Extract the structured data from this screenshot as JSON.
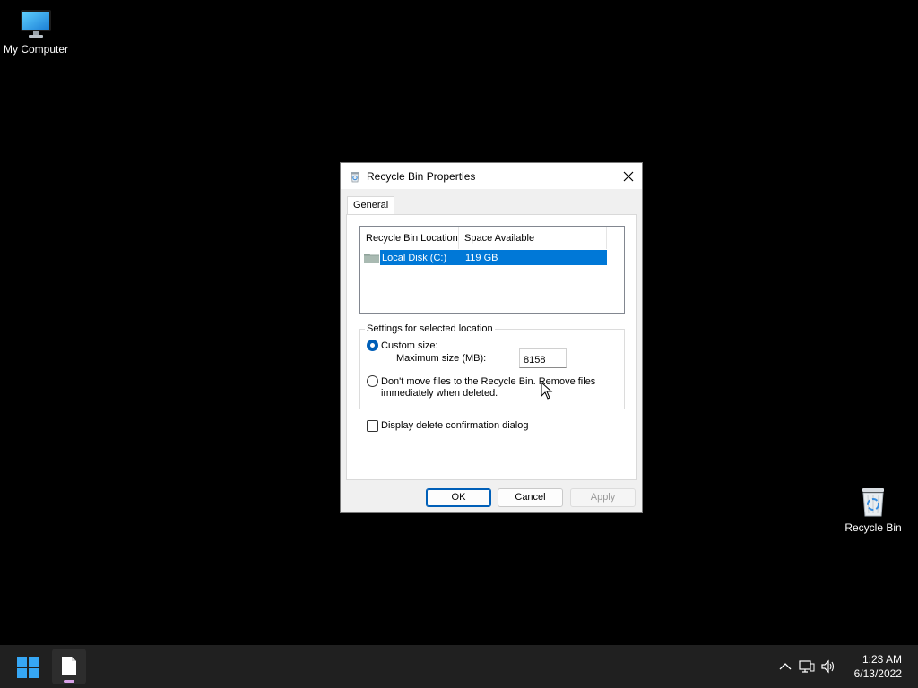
{
  "desktop": {
    "icons": [
      {
        "label": "My Computer",
        "icon": "monitor-icon"
      },
      {
        "label": "Recycle Bin",
        "icon": "recycle-bin-icon"
      }
    ]
  },
  "dialog": {
    "title": "Recycle Bin Properties",
    "tabs": [
      {
        "label": "General",
        "active": true
      }
    ],
    "list": {
      "columns": [
        "Recycle Bin Location",
        "Space Available"
      ],
      "rows": [
        {
          "location": "Local Disk (C:)",
          "space": "119 GB",
          "selected": true
        }
      ]
    },
    "settings": {
      "group_title": "Settings for selected location",
      "custom_size_label": "Custom size:",
      "max_size_label": "Maximum size (MB):",
      "max_size_value": "8158",
      "no_move_label_line1": "Don't move files to the Recycle Bin. Remove files",
      "no_move_label_line2": "immediately when deleted.",
      "selected_option": "custom_size"
    },
    "confirm_dialog_label": "Display delete confirmation dialog",
    "confirm_dialog_checked": false,
    "buttons": {
      "ok": "OK",
      "cancel": "Cancel",
      "apply": "Apply"
    }
  },
  "taskbar": {
    "time": "1:23 AM",
    "date": "6/13/2022",
    "tray_icons": [
      "chevron-up-icon",
      "network-icon",
      "volume-icon"
    ]
  },
  "colors": {
    "selection": "#0078d7",
    "accent": "#005fb8",
    "taskbar": "#202020"
  }
}
